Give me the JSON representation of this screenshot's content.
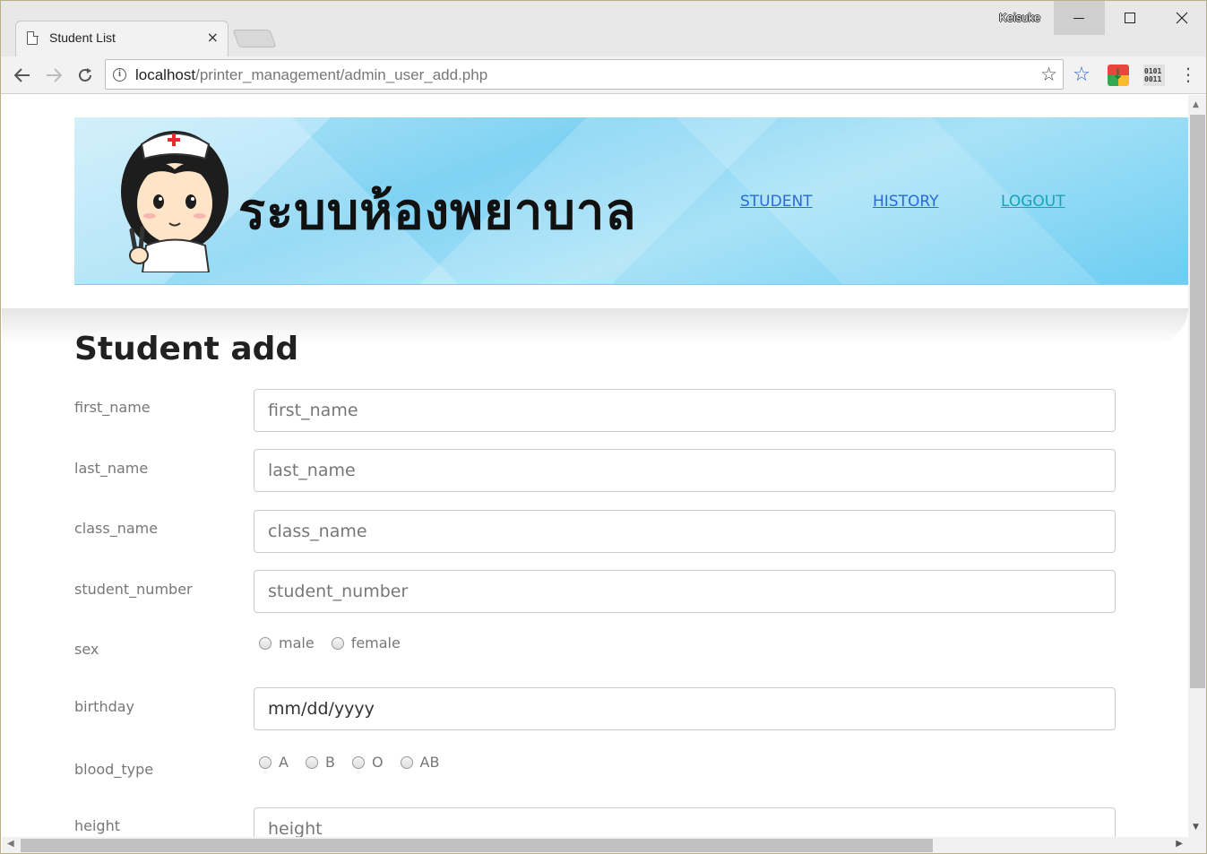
{
  "browser": {
    "tab_title": "Student List",
    "tab_close": "×",
    "profile_name": "Keisuke",
    "url_host": "localhost",
    "url_path": "/printer_management/admin_user_add.php",
    "icons": [
      "back-icon",
      "forward-icon",
      "reload-icon",
      "info-icon",
      "bookmark-star-icon",
      "extension-star-icon",
      "extension-download-icon",
      "extension-binary-icon",
      "menu-dots-icon"
    ]
  },
  "banner": {
    "title": "ระบบห้องพยาบาล",
    "nav": {
      "student": "STUDENT",
      "history": "HISTORY",
      "logout": "LOGOUT"
    }
  },
  "form": {
    "title": "Student add",
    "fields": {
      "first_name": {
        "label": "first_name",
        "placeholder": "first_name"
      },
      "last_name": {
        "label": "last_name",
        "placeholder": "last_name"
      },
      "class_name": {
        "label": "class_name",
        "placeholder": "class_name"
      },
      "student_number": {
        "label": "student_number",
        "placeholder": "student_number"
      },
      "sex": {
        "label": "sex",
        "options": [
          "male",
          "female"
        ]
      },
      "birthday": {
        "label": "birthday",
        "value": "mm/dd/yyyy"
      },
      "blood_type": {
        "label": "blood_type",
        "options": [
          "A",
          "B",
          "O",
          "AB"
        ]
      },
      "height": {
        "label": "height",
        "placeholder": "height"
      }
    }
  },
  "colors": {
    "link": "#2a6ad4",
    "logout_link": "#1aa3b5",
    "banner_bg": "#7fd2f3"
  }
}
